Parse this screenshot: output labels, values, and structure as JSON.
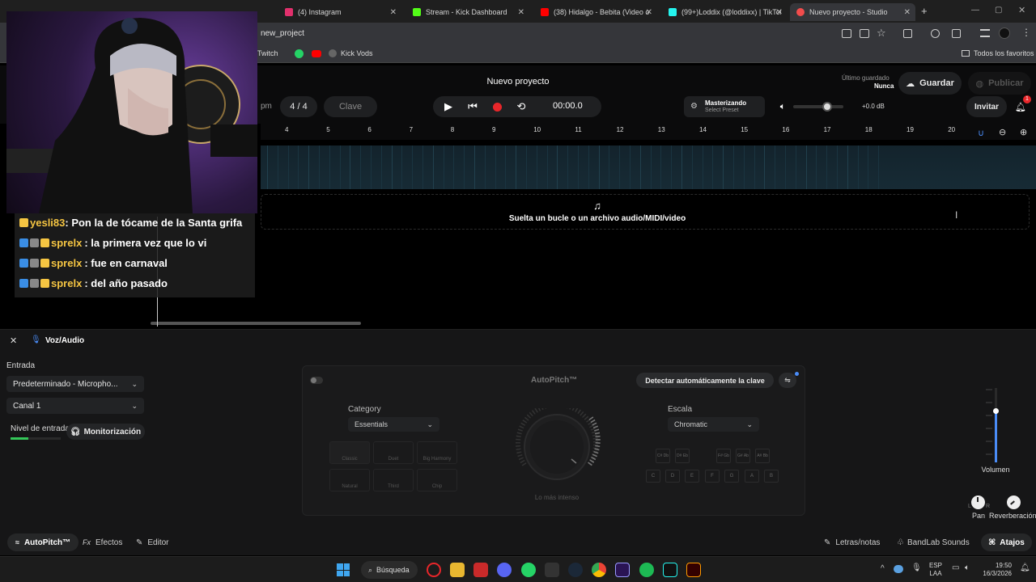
{
  "browser": {
    "tabs": [
      {
        "title": "(4) Instagram",
        "color": "#e1306c"
      },
      {
        "title": "Stream - Kick Dashboard",
        "color": "#53fc18"
      },
      {
        "title": "(38) Hidalgo - Bebita (Video of",
        "color": "#ff0000"
      },
      {
        "title": "(99+)Loddix (@loddixx) | TikTok",
        "color": "#25f4ee"
      },
      {
        "title": "Nuevo proyecto - Studio",
        "color": "#f24c4c"
      }
    ],
    "url": "new_project",
    "bookmarks": [
      "Twitch",
      "Kick Vods"
    ],
    "bookmarks_right": "Todos los favoritos"
  },
  "header": {
    "project_title": "Nuevo proyecto",
    "tempo_unit": "pm",
    "time_sig": "4 / 4",
    "key_label": "Clave",
    "time": "00:00.0",
    "mastering_title": "Masterizando",
    "mastering_sub": "Select Preset",
    "volume_db": "+0.0 dB",
    "last_saved_label": "Último guardado",
    "last_saved_value": "Nunca",
    "save_label": "Guardar",
    "publish_label": "Publicar",
    "invite_label": "Invitar",
    "notif_count": "1"
  },
  "ruler": [
    "4",
    "5",
    "6",
    "7",
    "8",
    "9",
    "10",
    "11",
    "12",
    "13",
    "14",
    "15",
    "16",
    "17",
    "18",
    "19",
    "20"
  ],
  "dropzone_text": "Suelta un bucle o un archivo audio/MIDI/video",
  "chat": [
    {
      "user": "yesli83",
      "msg": ": Pon la de tócame de la Santa grifa",
      "user_color": "#f5c542"
    },
    {
      "user": "sprelx",
      "msg": ": la primera vez que lo vi",
      "user_color": "#f5c542"
    },
    {
      "user": "sprelx",
      "msg": ": fue en carnaval",
      "user_color": "#f5c542"
    },
    {
      "user": "sprelx",
      "msg": ": del año pasado",
      "user_color": "#f5c542"
    }
  ],
  "panel": {
    "track_name": "Voz/Audio",
    "input_label": "Entrada",
    "input_device": "Predeterminado - Micropho...",
    "channel": "Canal 1",
    "level_label": "Nivel de entrada",
    "monitor_label": "Monitorización",
    "input_level": 0.35
  },
  "autopitch": {
    "title": "AutoPitch™",
    "detect_label": "Detectar automáticamente la clave",
    "category_label": "Category",
    "category_value": "Essentials",
    "scale_label": "Escala",
    "scale_value": "Chromatic",
    "effects": [
      "Classic",
      "Duet",
      "Big Harmony",
      "Natural",
      "Third",
      "Chip"
    ],
    "dial_label": "Lo más intenso",
    "sharp_keys": [
      "C#\nDb",
      "D#\nEb",
      "F#\nGb",
      "G#\nAb",
      "A#\nBb"
    ],
    "keys": [
      "C",
      "D",
      "E",
      "F",
      "G",
      "A",
      "B"
    ]
  },
  "mixer": {
    "volume_label": "Volumen",
    "pan_label": "Pan",
    "reverb_label": "Reverberación",
    "pan_l": "L",
    "pan_r": "R",
    "volume_level": 0.7
  },
  "bottom": {
    "autopitch_tab": "AutoPitch™",
    "effects_tab": "Efectos",
    "editor_tab": "Editor",
    "lyrics": "Letras/notas",
    "sounds": "BandLab Sounds",
    "shortcuts": "Atajos"
  },
  "taskbar": {
    "search": "Búsqueda",
    "lang_top": "ESP",
    "lang_bottom": "LAA",
    "time": "19:50",
    "date": "16/3/2026"
  }
}
